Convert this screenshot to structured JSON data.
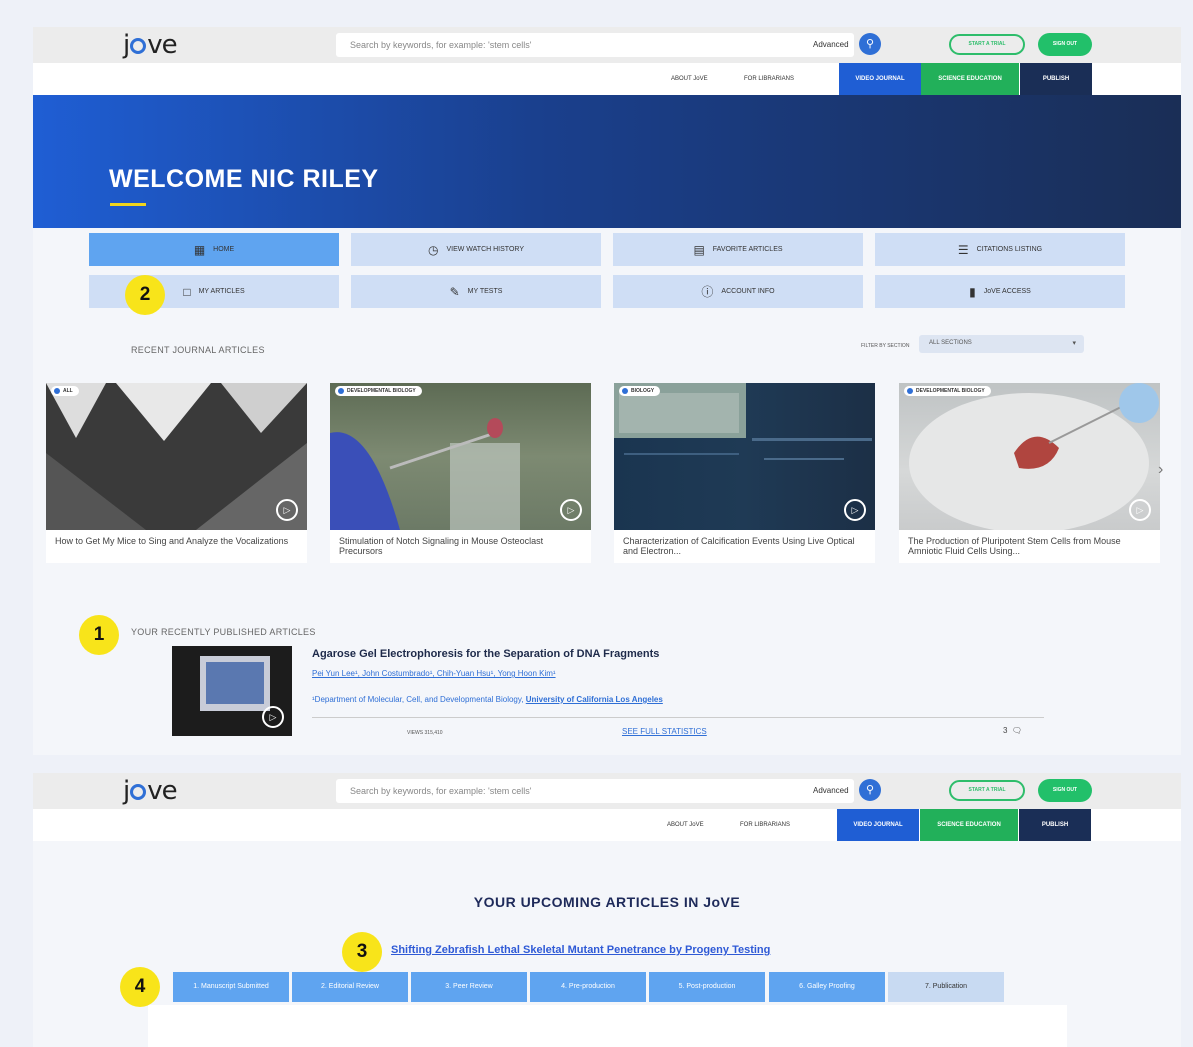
{
  "header": {
    "logo": "jove",
    "search_placeholder": "Search by keywords, for example: 'stem cells'",
    "advanced_label": "Advanced",
    "trial_label": "START A TRIAL",
    "signin_label": "SIGN OUT",
    "nav_links": [
      "ABOUT JoVE",
      "FOR LIBRARIANS"
    ],
    "nav_tabs": [
      {
        "label": "VIDEO JOURNAL",
        "color": "#1f5ed4"
      },
      {
        "label": "SCIENCE EDUCATION",
        "color": "#22b05a"
      },
      {
        "label": "PUBLISH",
        "color": "#1a2e56"
      }
    ]
  },
  "hero": {
    "title": "WELCOME NIC RILEY",
    "accent": "#f0d51c"
  },
  "menu": [
    {
      "label": "HOME",
      "icon": "home-icon",
      "active": true
    },
    {
      "label": "VIEW WATCH HISTORY",
      "icon": "history-icon",
      "active": false
    },
    {
      "label": "FAVORITE ARTICLES",
      "icon": "favorite-icon",
      "active": false
    },
    {
      "label": "CITATIONS LISTING",
      "icon": "citations-icon",
      "active": false
    },
    {
      "label": "MY ARTICLES",
      "icon": "articles-icon",
      "active": false
    },
    {
      "label": "MY TESTS",
      "icon": "tests-icon",
      "active": false
    },
    {
      "label": "ACCOUNT INFO",
      "icon": "info-icon",
      "active": false
    },
    {
      "label": "JoVE ACCESS",
      "icon": "access-icon",
      "active": false
    }
  ],
  "callouts": [
    "1",
    "2",
    "3",
    "4"
  ],
  "recent": {
    "label": "RECENT JOURNAL ARTICLES",
    "filter_label": "FILTER BY SECTION",
    "filter_value": "ALL SECTIONS",
    "cards": [
      {
        "tag": "ALL",
        "title": "How to Get My Mice to Sing and Analyze the Vocalizations"
      },
      {
        "tag": "DEVELOPMENTAL BIOLOGY",
        "title": "Stimulation of Notch Signaling in Mouse Osteoclast Precursors"
      },
      {
        "tag": "BIOLOGY",
        "title": "Characterization of Calcification Events Using Live Optical and Electron..."
      },
      {
        "tag": "DEVELOPMENTAL BIOLOGY",
        "title": "The Production of Pluripotent Stem Cells from Mouse Amniotic Fluid Cells Using..."
      }
    ]
  },
  "published": {
    "label": "YOUR RECENTLY PUBLISHED ARTICLES",
    "title": "Agarose Gel Electrophoresis for the Separation of DNA Fragments",
    "authors": "Pei Yun Lee¹, John Costumbrado¹, Chih-Yuan Hsu¹, Yong Hoon Kim¹",
    "affiliation_prefix": "¹Department of Molecular, Cell, and Developmental Biology,",
    "affiliation_univ": "University of California Los Angeles",
    "views": "VIEWS 315,410",
    "stats_link": "SEE FULL STATISTICS",
    "comments": "3"
  },
  "upcoming": {
    "heading": "YOUR UPCOMING ARTICLES IN JoVE",
    "article_title": "Shifting Zebrafish Lethal Skeletal Mutant Penetrance by Progeny Testing",
    "stages": [
      {
        "label": "1. Manuscript Submitted",
        "done": true
      },
      {
        "label": "2. Editorial Review",
        "done": true
      },
      {
        "label": "3. Peer Review",
        "done": true
      },
      {
        "label": "4. Pre-production",
        "done": true
      },
      {
        "label": "5. Post-production",
        "done": true
      },
      {
        "label": "6. Galley Proofing",
        "done": true
      },
      {
        "label": "7. Publication",
        "done": false
      }
    ]
  }
}
